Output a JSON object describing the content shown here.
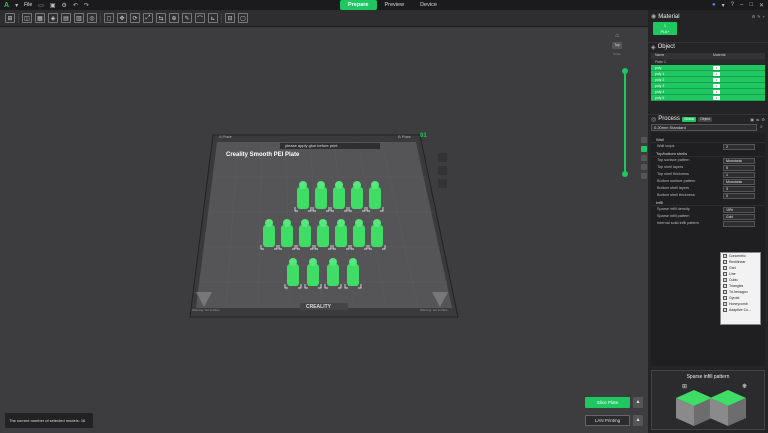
{
  "titlebar": {
    "logo": "A",
    "file_label": "File",
    "tabs": [
      "Prepare",
      "Preview",
      "Device"
    ]
  },
  "plate": {
    "label_left": "A Plate",
    "center_note": "please apply glue before print",
    "label_right": "B Plate",
    "title": "Creality Smooth PEI Plate",
    "number": "01",
    "brand": "CREALITY",
    "warn_left": "Warning: hot surface",
    "warn_right": "Warning: hot surface"
  },
  "viewport": {
    "top_btn": "Top",
    "side_btn": "Scale"
  },
  "status": {
    "text": "The current number of selected models: 16"
  },
  "actions": {
    "slice": "Slice Plate",
    "lan": "LAN Printing"
  },
  "material": {
    "title": "Material",
    "chip_num": "1",
    "chip_label": "PLA+"
  },
  "object": {
    "title": "Object",
    "col_name": "Name",
    "col_material": "Material",
    "plate_row": "Plate 1",
    "rows": [
      {
        "name": "poly",
        "mat": "1"
      },
      {
        "name": "poly 1",
        "mat": "1"
      },
      {
        "name": "poly 2",
        "mat": "1"
      },
      {
        "name": "poly 3",
        "mat": "1"
      },
      {
        "name": "poly 4",
        "mat": "1"
      },
      {
        "name": "poly 5",
        "mat": "1"
      }
    ]
  },
  "process": {
    "title": "Process",
    "tag_global": "Global",
    "tag_object": "Object",
    "preset": "0.20mm Standard",
    "groups": {
      "wall": "Wall",
      "shells": "Top/bottom shells",
      "infill": "Infill"
    },
    "wall_rows": [
      {
        "k": "Wall loops",
        "v": "2"
      }
    ],
    "shell_rows": [
      {
        "k": "Top surface pattern",
        "v": "Monotonic"
      },
      {
        "k": "Top shell layers",
        "v": "5"
      },
      {
        "k": "Top shell thickness",
        "v": "1"
      },
      {
        "k": "Bottom surface pattern",
        "v": "Monotonic"
      },
      {
        "k": "Bottom shell layers",
        "v": "3"
      },
      {
        "k": "Bottom shell thickness",
        "v": "0"
      }
    ],
    "infill_rows": [
      {
        "k": "Sparse infill density",
        "v": "15%"
      },
      {
        "k": "Sparse infill pattern",
        "v": "Grid"
      },
      {
        "k": "Internal solid infill pattern",
        "v": ""
      }
    ]
  },
  "dropdown_options": [
    "Concentric",
    "Rectilinear",
    "Grid",
    "Line",
    "Cubic",
    "Triangles",
    "Tri-hexagon",
    "Gyroid",
    "Honeycomb",
    "Adaptive Cu..."
  ],
  "preview": {
    "title": "Sparse infill pattern"
  },
  "colors": {
    "accent": "#1ec760",
    "plate": "#2d2d30",
    "model": "#3fdc66"
  }
}
